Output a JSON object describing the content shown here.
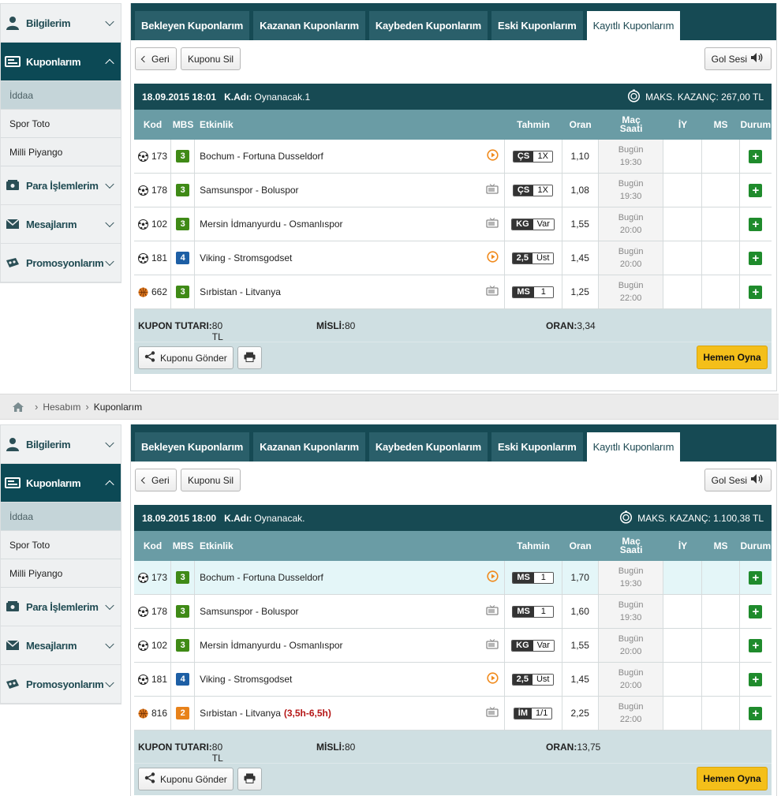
{
  "breadcrumb": {
    "items": [
      "Hesabım",
      "Kuponlarım"
    ]
  },
  "colors": {
    "sidebar_active": "#0c4955",
    "header": "#174a53",
    "table_head": "#6a9ca5",
    "play": "#f4bf1a",
    "mbs_green": "#3f8a16",
    "mbs_blue": "#1d5fa5",
    "mbs_orange": "#e8821a"
  },
  "panels": [
    {
      "sidebar": {
        "items": [
          {
            "label": "Bilgilerim",
            "icon": "user-icon"
          },
          {
            "label": "Kuponlarım",
            "icon": "ticket-icon"
          },
          {
            "label": "Para İşlemlerim",
            "icon": "money-icon"
          },
          {
            "label": "Mesajlarım",
            "icon": "envelope-icon"
          },
          {
            "label": "Promosyonlarım",
            "icon": "promo-icon"
          }
        ],
        "sub": [
          "İddaa",
          "Spor Toto",
          "Milli Piyango"
        ]
      },
      "tabs": [
        "Bekleyen Kuponlarım",
        "Kazanan Kuponlarım",
        "Kaybeden Kuponlarım",
        "Eski Kuponlarım",
        "Kayıtlı Kuponlarım"
      ],
      "buttons": {
        "back": "Geri",
        "delete": "Kuponu Sil",
        "goal": "Gol Sesi"
      },
      "coupon": {
        "date": "18.09.2015 18:01",
        "name_label": "K.Adı:",
        "name": "Oynanacak.1",
        "max_win": "MAKS. KAZANÇ: 267,00 TL",
        "headers": {
          "kod": "Kod",
          "mbs": "MBS",
          "etkinlik": "Etkinlik",
          "tahmin": "Tahmin",
          "oran": "Oran",
          "mac_saati_1": "Maç",
          "mac_saati_2": "Saati",
          "iy": "İY",
          "ms": "MS",
          "durum": "Durum"
        },
        "rows": [
          {
            "sport": "football",
            "kod": "173",
            "mbs": "3",
            "mbs_color": "#3f8a16",
            "event": "Bochum - Fortuna Dusseldorf",
            "extra": "",
            "media": "live-icon",
            "pa": "ÇS",
            "pb": "1X",
            "oran": "1,10",
            "day": "Bugün",
            "time": "19:30"
          },
          {
            "sport": "football",
            "kod": "178",
            "mbs": "3",
            "mbs_color": "#3f8a16",
            "event": "Samsunspor - Boluspor",
            "extra": "",
            "media": "tv-icon",
            "pa": "ÇS",
            "pb": "1X",
            "oran": "1,08",
            "day": "Bugün",
            "time": "19:30"
          },
          {
            "sport": "football",
            "kod": "102",
            "mbs": "3",
            "mbs_color": "#3f8a16",
            "event": "Mersin İdmanyurdu - Osmanlıspor",
            "extra": "",
            "media": "tv-icon",
            "pa": "KG",
            "pb": "Var",
            "oran": "1,55",
            "day": "Bugün",
            "time": "20:00"
          },
          {
            "sport": "football",
            "kod": "181",
            "mbs": "4",
            "mbs_color": "#1d5fa5",
            "event": "Viking - Stromsgodset",
            "extra": "",
            "media": "live-icon",
            "pa": "2,5",
            "pb": "Üst",
            "oran": "1,45",
            "day": "Bugün",
            "time": "20:00"
          },
          {
            "sport": "basketball",
            "kod": "662",
            "mbs": "3",
            "mbs_color": "#3f8a16",
            "event": "Sırbistan - Litvanya",
            "extra": "",
            "media": "tv-icon",
            "pa": "MS",
            "pb": "1",
            "oran": "1,25",
            "day": "Bugün",
            "time": "22:00"
          }
        ],
        "totals": {
          "tutar_label": "KUPON TUTARI:",
          "tutar": "80 TL",
          "misli_label": "MİSLİ:",
          "misli": "80",
          "oran_label": "ORAN:",
          "oran": "3,34"
        },
        "send": "Kuponu Gönder",
        "play": "Hemen Oyna"
      }
    },
    {
      "sidebar": {
        "items": [
          {
            "label": "Bilgilerim",
            "icon": "user-icon"
          },
          {
            "label": "Kuponlarım",
            "icon": "ticket-icon"
          },
          {
            "label": "Para İşlemlerim",
            "icon": "money-icon"
          },
          {
            "label": "Mesajlarım",
            "icon": "envelope-icon"
          },
          {
            "label": "Promosyonlarım",
            "icon": "promo-icon"
          }
        ],
        "sub": [
          "İddaa",
          "Spor Toto",
          "Milli Piyango"
        ]
      },
      "tabs": [
        "Bekleyen Kuponlarım",
        "Kazanan Kuponlarım",
        "Kaybeden Kuponlarım",
        "Eski Kuponlarım",
        "Kayıtlı Kuponlarım"
      ],
      "buttons": {
        "back": "Geri",
        "delete": "Kuponu Sil",
        "goal": "Gol Sesi"
      },
      "coupon": {
        "date": "18.09.2015 18:00",
        "name_label": "K.Adı:",
        "name": "Oynanacak.",
        "max_win": "MAKS. KAZANÇ: 1.100,38 TL",
        "headers": {
          "kod": "Kod",
          "mbs": "MBS",
          "etkinlik": "Etkinlik",
          "tahmin": "Tahmin",
          "oran": "Oran",
          "mac_saati_1": "Maç",
          "mac_saati_2": "Saati",
          "iy": "İY",
          "ms": "MS",
          "durum": "Durum"
        },
        "rows": [
          {
            "sport": "football",
            "kod": "173",
            "mbs": "3",
            "mbs_color": "#3f8a16",
            "event": "Bochum - Fortuna Dusseldorf",
            "extra": "",
            "media": "live-icon",
            "pa": "MS",
            "pb": "1",
            "oran": "1,70",
            "day": "Bugün",
            "time": "19:30"
          },
          {
            "sport": "football",
            "kod": "178",
            "mbs": "3",
            "mbs_color": "#3f8a16",
            "event": "Samsunspor - Boluspor",
            "extra": "",
            "media": "tv-icon",
            "pa": "MS",
            "pb": "1",
            "oran": "1,60",
            "day": "Bugün",
            "time": "19:30"
          },
          {
            "sport": "football",
            "kod": "102",
            "mbs": "3",
            "mbs_color": "#3f8a16",
            "event": "Mersin İdmanyurdu - Osmanlıspor",
            "extra": "",
            "media": "tv-icon",
            "pa": "KG",
            "pb": "Var",
            "oran": "1,55",
            "day": "Bugün",
            "time": "20:00"
          },
          {
            "sport": "football",
            "kod": "181",
            "mbs": "4",
            "mbs_color": "#1d5fa5",
            "event": "Viking - Stromsgodset",
            "extra": "",
            "media": "live-icon",
            "pa": "2,5",
            "pb": "Üst",
            "oran": "1,45",
            "day": "Bugün",
            "time": "20:00"
          },
          {
            "sport": "basketball",
            "kod": "816",
            "mbs": "2",
            "mbs_color": "#e8821a",
            "event": "Sırbistan - Litvanya",
            "extra": "(3,5h-6,5h)",
            "media": "tv-icon",
            "pa": "İM",
            "pb": "1/1",
            "oran": "2,25",
            "day": "Bugün",
            "time": "22:00"
          }
        ],
        "totals": {
          "tutar_label": "KUPON TUTARI:",
          "tutar": "80 TL",
          "misli_label": "MİSLİ:",
          "misli": "80",
          "oran_label": "ORAN:",
          "oran": "13,75"
        },
        "send": "Kuponu Gönder",
        "play": "Hemen Oyna"
      }
    }
  ]
}
